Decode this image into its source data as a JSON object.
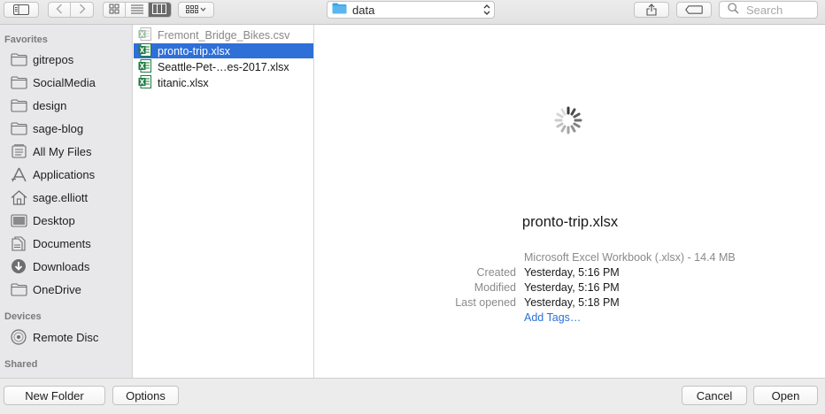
{
  "toolbar": {
    "icons": [
      "sidebar-toggle-icon",
      "back-arrow-icon",
      "forward-arrow-icon",
      "icon-view-icon",
      "list-view-icon",
      "column-view-icon",
      "group-by-icon",
      "share-icon",
      "tag-icon",
      "search-icon"
    ],
    "location": "data",
    "search_placeholder": "Search"
  },
  "sidebar": {
    "favorites_header": "Favorites",
    "favorites": [
      {
        "label": "gitrepos",
        "icon": "folder-icon"
      },
      {
        "label": "SocialMedia",
        "icon": "folder-icon"
      },
      {
        "label": "design",
        "icon": "folder-icon"
      },
      {
        "label": "sage-blog",
        "icon": "folder-icon"
      },
      {
        "label": "All My Files",
        "icon": "all-files-icon"
      },
      {
        "label": "Applications",
        "icon": "applications-icon"
      },
      {
        "label": "sage.elliott",
        "icon": "home-icon"
      },
      {
        "label": "Desktop",
        "icon": "desktop-icon"
      },
      {
        "label": "Documents",
        "icon": "documents-icon"
      },
      {
        "label": "Downloads",
        "icon": "downloads-icon"
      },
      {
        "label": "OneDrive",
        "icon": "folder-icon"
      }
    ],
    "devices_header": "Devices",
    "devices": [
      {
        "label": "Remote Disc",
        "icon": "disc-icon"
      }
    ],
    "shared_header": "Shared"
  },
  "files": [
    {
      "name": "Fremont_Bridge_Bikes.csv",
      "type": "csv",
      "dimmed": true,
      "selected": false
    },
    {
      "name": "pronto-trip.xlsx",
      "type": "xlsx",
      "dimmed": false,
      "selected": true
    },
    {
      "name": "Seattle-Pet-…es-2017.xlsx",
      "type": "xlsx",
      "dimmed": false,
      "selected": false
    },
    {
      "name": "titanic.xlsx",
      "type": "xlsx",
      "dimmed": false,
      "selected": false
    }
  ],
  "preview": {
    "filename": "pronto-trip.xlsx",
    "kind": "Microsoft Excel Workbook (.xlsx) - 14.4 MB",
    "created_label": "Created",
    "created": "Yesterday, 5:16 PM",
    "modified_label": "Modified",
    "modified": "Yesterday, 5:16 PM",
    "last_opened_label": "Last opened",
    "last_opened": "Yesterday, 5:18 PM",
    "add_tags": "Add Tags…"
  },
  "buttons": {
    "new_folder": "New Folder",
    "options": "Options",
    "cancel": "Cancel",
    "open": "Open"
  },
  "colors": {
    "selection": "#2e6fd8",
    "link": "#2d6fd6",
    "excel_green": "#1d7a3f",
    "folder_blue": "#3aa3e8"
  }
}
